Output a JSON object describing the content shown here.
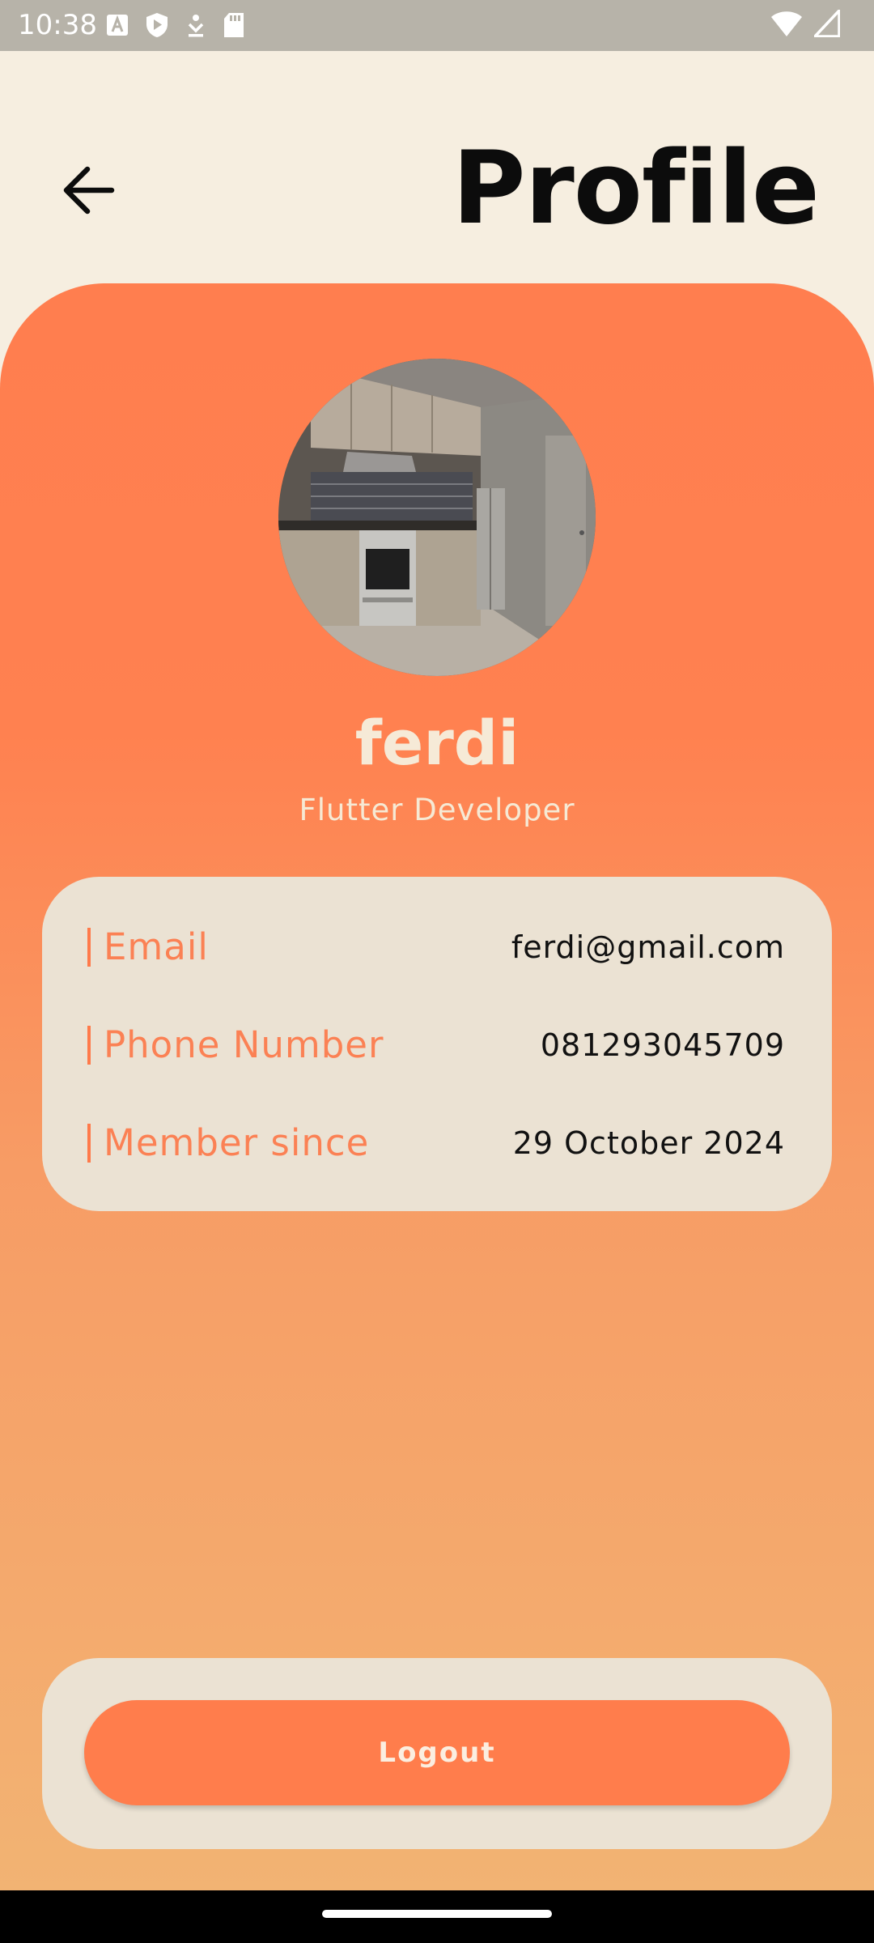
{
  "status_bar": {
    "time": "10:38"
  },
  "header": {
    "title": "Profile"
  },
  "profile": {
    "name": "ferdi",
    "role": "Flutter Developer"
  },
  "info": {
    "email_label": "Email",
    "email_value": "ferdi@gmail.com",
    "phone_label": "Phone Number",
    "phone_value": "081293045709",
    "member_label": "Member since",
    "member_value": "29 October 2024"
  },
  "actions": {
    "logout_label": "Logout"
  },
  "colors": {
    "accent": "#ff7e4f",
    "background": "#f6eee0",
    "card": "#ebe2d3",
    "label": "#fb8154",
    "status_bar": "#b7b3a9"
  },
  "icons": {
    "back": "arrow-left-icon",
    "wifi": "wifi-icon",
    "signal": "signal-icon"
  }
}
